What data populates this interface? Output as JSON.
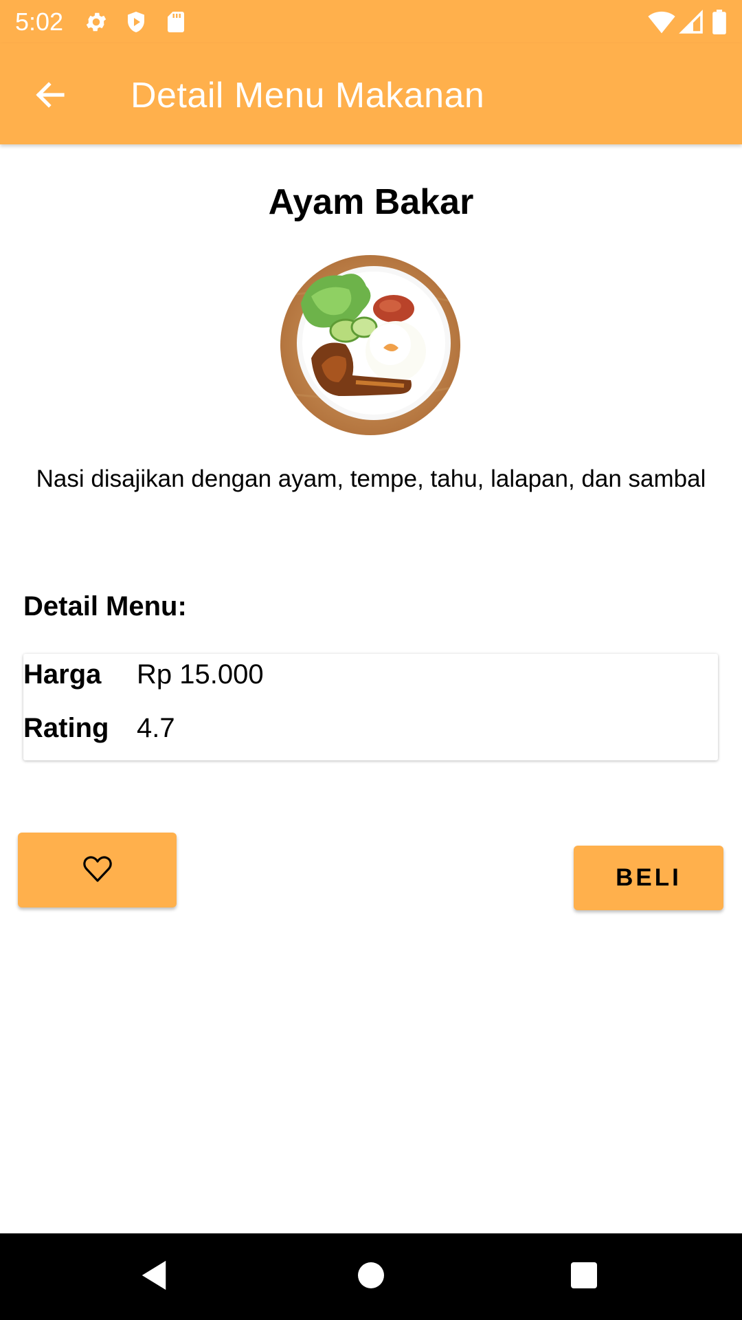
{
  "status_bar": {
    "time": "5:02",
    "left_icons": [
      "gear-icon",
      "shield-icon",
      "sd-card-icon"
    ],
    "right_icons": [
      "wifi-icon",
      "signal-icon",
      "battery-icon"
    ]
  },
  "app_bar": {
    "title": "Detail Menu Makanan",
    "back_icon": "arrow-back-icon",
    "color": "#FFB04C"
  },
  "menu": {
    "name": "Ayam Bakar",
    "image": "grilled-chicken-rice-plate",
    "description": "Nasi disajikan dengan ayam, tempe, tahu, lalapan, dan sambal"
  },
  "details": {
    "heading": "Detail Menu:",
    "rows": [
      {
        "label": "Harga",
        "value": "Rp 15.000"
      },
      {
        "label": "Rating",
        "value": "4.7"
      }
    ]
  },
  "actions": {
    "favorite_icon": "heart-outline-icon",
    "buy_label": "BELI"
  },
  "nav_bar": {
    "icons": [
      "back-triangle-icon",
      "home-circle-icon",
      "recents-square-icon"
    ]
  }
}
